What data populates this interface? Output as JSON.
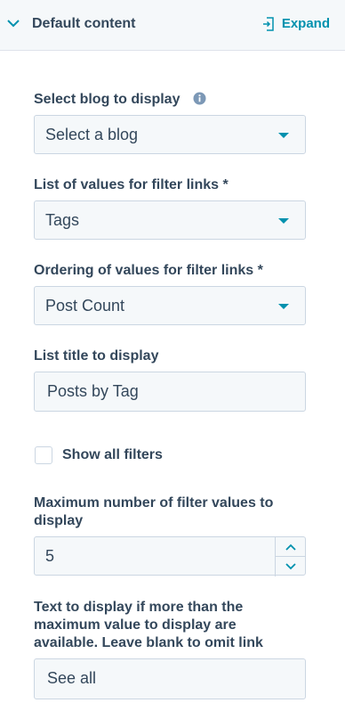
{
  "header": {
    "title": "Default content",
    "expand_label": "Expand"
  },
  "fields": {
    "blog": {
      "label": "Select blog to display",
      "value": "Select a blog"
    },
    "filter_values": {
      "label": "List of values for filter links *",
      "value": "Tags"
    },
    "ordering": {
      "label": "Ordering of values for filter links *",
      "value": "Post Count"
    },
    "list_title": {
      "label": "List title to display",
      "value": "Posts by Tag"
    },
    "show_all": {
      "label": "Show all filters",
      "checked": false
    },
    "max_values": {
      "label_line1": "Maximum number of filter values to",
      "label_line2": "display",
      "value": "5"
    },
    "see_all": {
      "label_line1": "Text to display if more than the",
      "label_line2": "maximum value to display are",
      "label_line3": "available. Leave blank to omit link",
      "value": "See all"
    }
  },
  "colors": {
    "accent": "#0091ae",
    "text": "#33475b",
    "field_bg": "#f5f8fa",
    "border": "#cbd6e2"
  }
}
